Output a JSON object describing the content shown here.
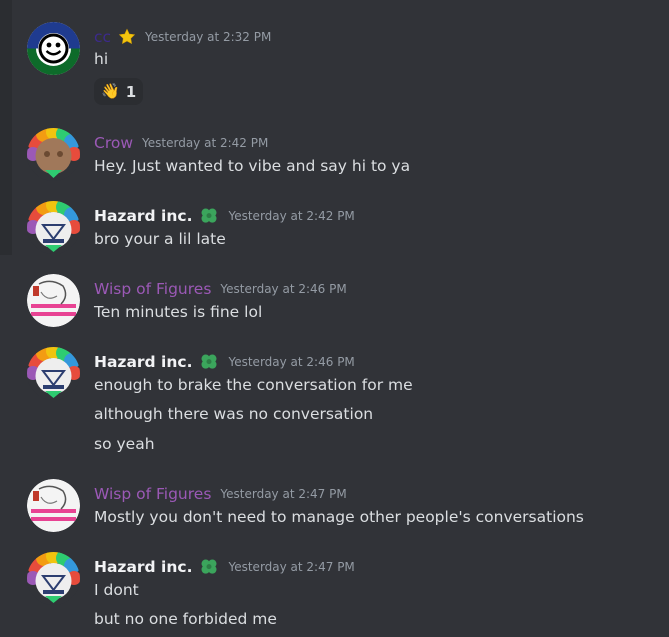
{
  "colors": {
    "background": "#313338",
    "text": "#dbdee1",
    "timestamp": "#949ba4",
    "purple_name": "#9b59b6",
    "white_name": "#f2f3f5",
    "green_badge": "#3ba55c",
    "star": "#f1c40f"
  },
  "messages": [
    {
      "username": "cc",
      "name_color": "#3c2a8c",
      "badge_icon": "star-icon",
      "timestamp": "Yesterday at 2:32 PM",
      "lines": [
        "hi"
      ],
      "reaction": {
        "emoji": "👋",
        "count": "1"
      }
    },
    {
      "username": "Crow",
      "name_color": "#9b59b6",
      "timestamp": "Yesterday at 2:42 PM",
      "lines": [
        "Hey. Just wanted to vibe and say hi to ya"
      ]
    },
    {
      "username": "Hazard inc.",
      "name_color": "#f2f3f5",
      "badge_icon": "flower-icon",
      "timestamp": "Yesterday at 2:42 PM",
      "lines": [
        "bro your a lil late"
      ]
    },
    {
      "username": "Wisp of Figures",
      "name_color": "#9b59b6",
      "timestamp": "Yesterday at 2:46 PM",
      "lines": [
        "Ten minutes is fine lol"
      ]
    },
    {
      "username": "Hazard inc.",
      "name_color": "#f2f3f5",
      "badge_icon": "flower-icon",
      "timestamp": "Yesterday at 2:46 PM",
      "lines": [
        "enough to brake the conversation for me",
        "although there was no conversation",
        "so yeah"
      ]
    },
    {
      "username": "Wisp of Figures",
      "name_color": "#9b59b6",
      "timestamp": "Yesterday at 2:47 PM",
      "lines": [
        "Mostly you don't need to manage other people's conversations"
      ]
    },
    {
      "username": "Hazard inc.",
      "name_color": "#f2f3f5",
      "badge_icon": "flower-icon",
      "timestamp": "Yesterday at 2:47 PM",
      "lines": [
        "I dont",
        "but no one forbided me"
      ]
    }
  ]
}
